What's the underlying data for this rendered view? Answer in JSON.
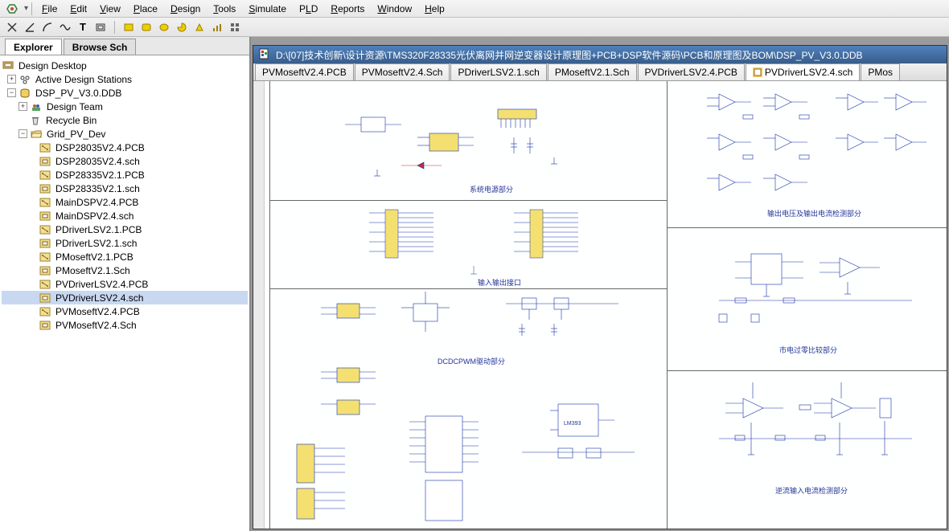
{
  "menu": {
    "items": [
      "File",
      "Edit",
      "View",
      "Place",
      "Design",
      "Tools",
      "Simulate",
      "PLD",
      "Reports",
      "Window",
      "Help"
    ]
  },
  "lefttabs": {
    "explorer": "Explorer",
    "browse": "Browse Sch"
  },
  "tree": {
    "root": "Design Desktop",
    "stations": "Active Design Stations",
    "ddb": "DSP_PV_V3.0.DDB",
    "team": "Design Team",
    "recycle": "Recycle Bin",
    "folder": "Grid_PV_Dev",
    "files": [
      "DSP28035V2.4.PCB",
      "DSP28035V2.4.sch",
      "DSP28335V2.1.PCB",
      "DSP28335V2.1.sch",
      "MainDSPV2.4.PCB",
      "MainDSPV2.4.sch",
      "PDriverLSV2.1.PCB",
      "PDriverLSV2.1.sch",
      "PMoseftV2.1.PCB",
      "PMoseftV2.1.Sch",
      "PVDriverLSV2.4.PCB",
      "PVDriverLSV2.4.sch",
      "PVMoseftV2.4.PCB",
      "PVMoseftV2.4.Sch"
    ]
  },
  "doctitle": "D:\\[07]技术创新\\设计资源\\TMS320F28335光伏离网并网逆变器设计原理图+PCB+DSP软件源码\\PCB和原理图及BOM\\DSP_PV_V3.0.DDB",
  "doctabs": [
    "PVMoseftV2.4.PCB",
    "PVMoseftV2.4.Sch",
    "PDriverLSV2.1.sch",
    "PMoseftV2.1.Sch",
    "PVDriverLSV2.4.PCB",
    "PVDriverLSV2.4.sch",
    "PMos"
  ],
  "schematic_labels": {
    "block1": "系统电源部分",
    "block2": "输入输出接口",
    "block3": "DCDCPWM驱动部分",
    "block4": "输出电压及输出电流检测部分",
    "block5": "市电过零比较部分",
    "block6": "逆流输入电流检测部分"
  }
}
